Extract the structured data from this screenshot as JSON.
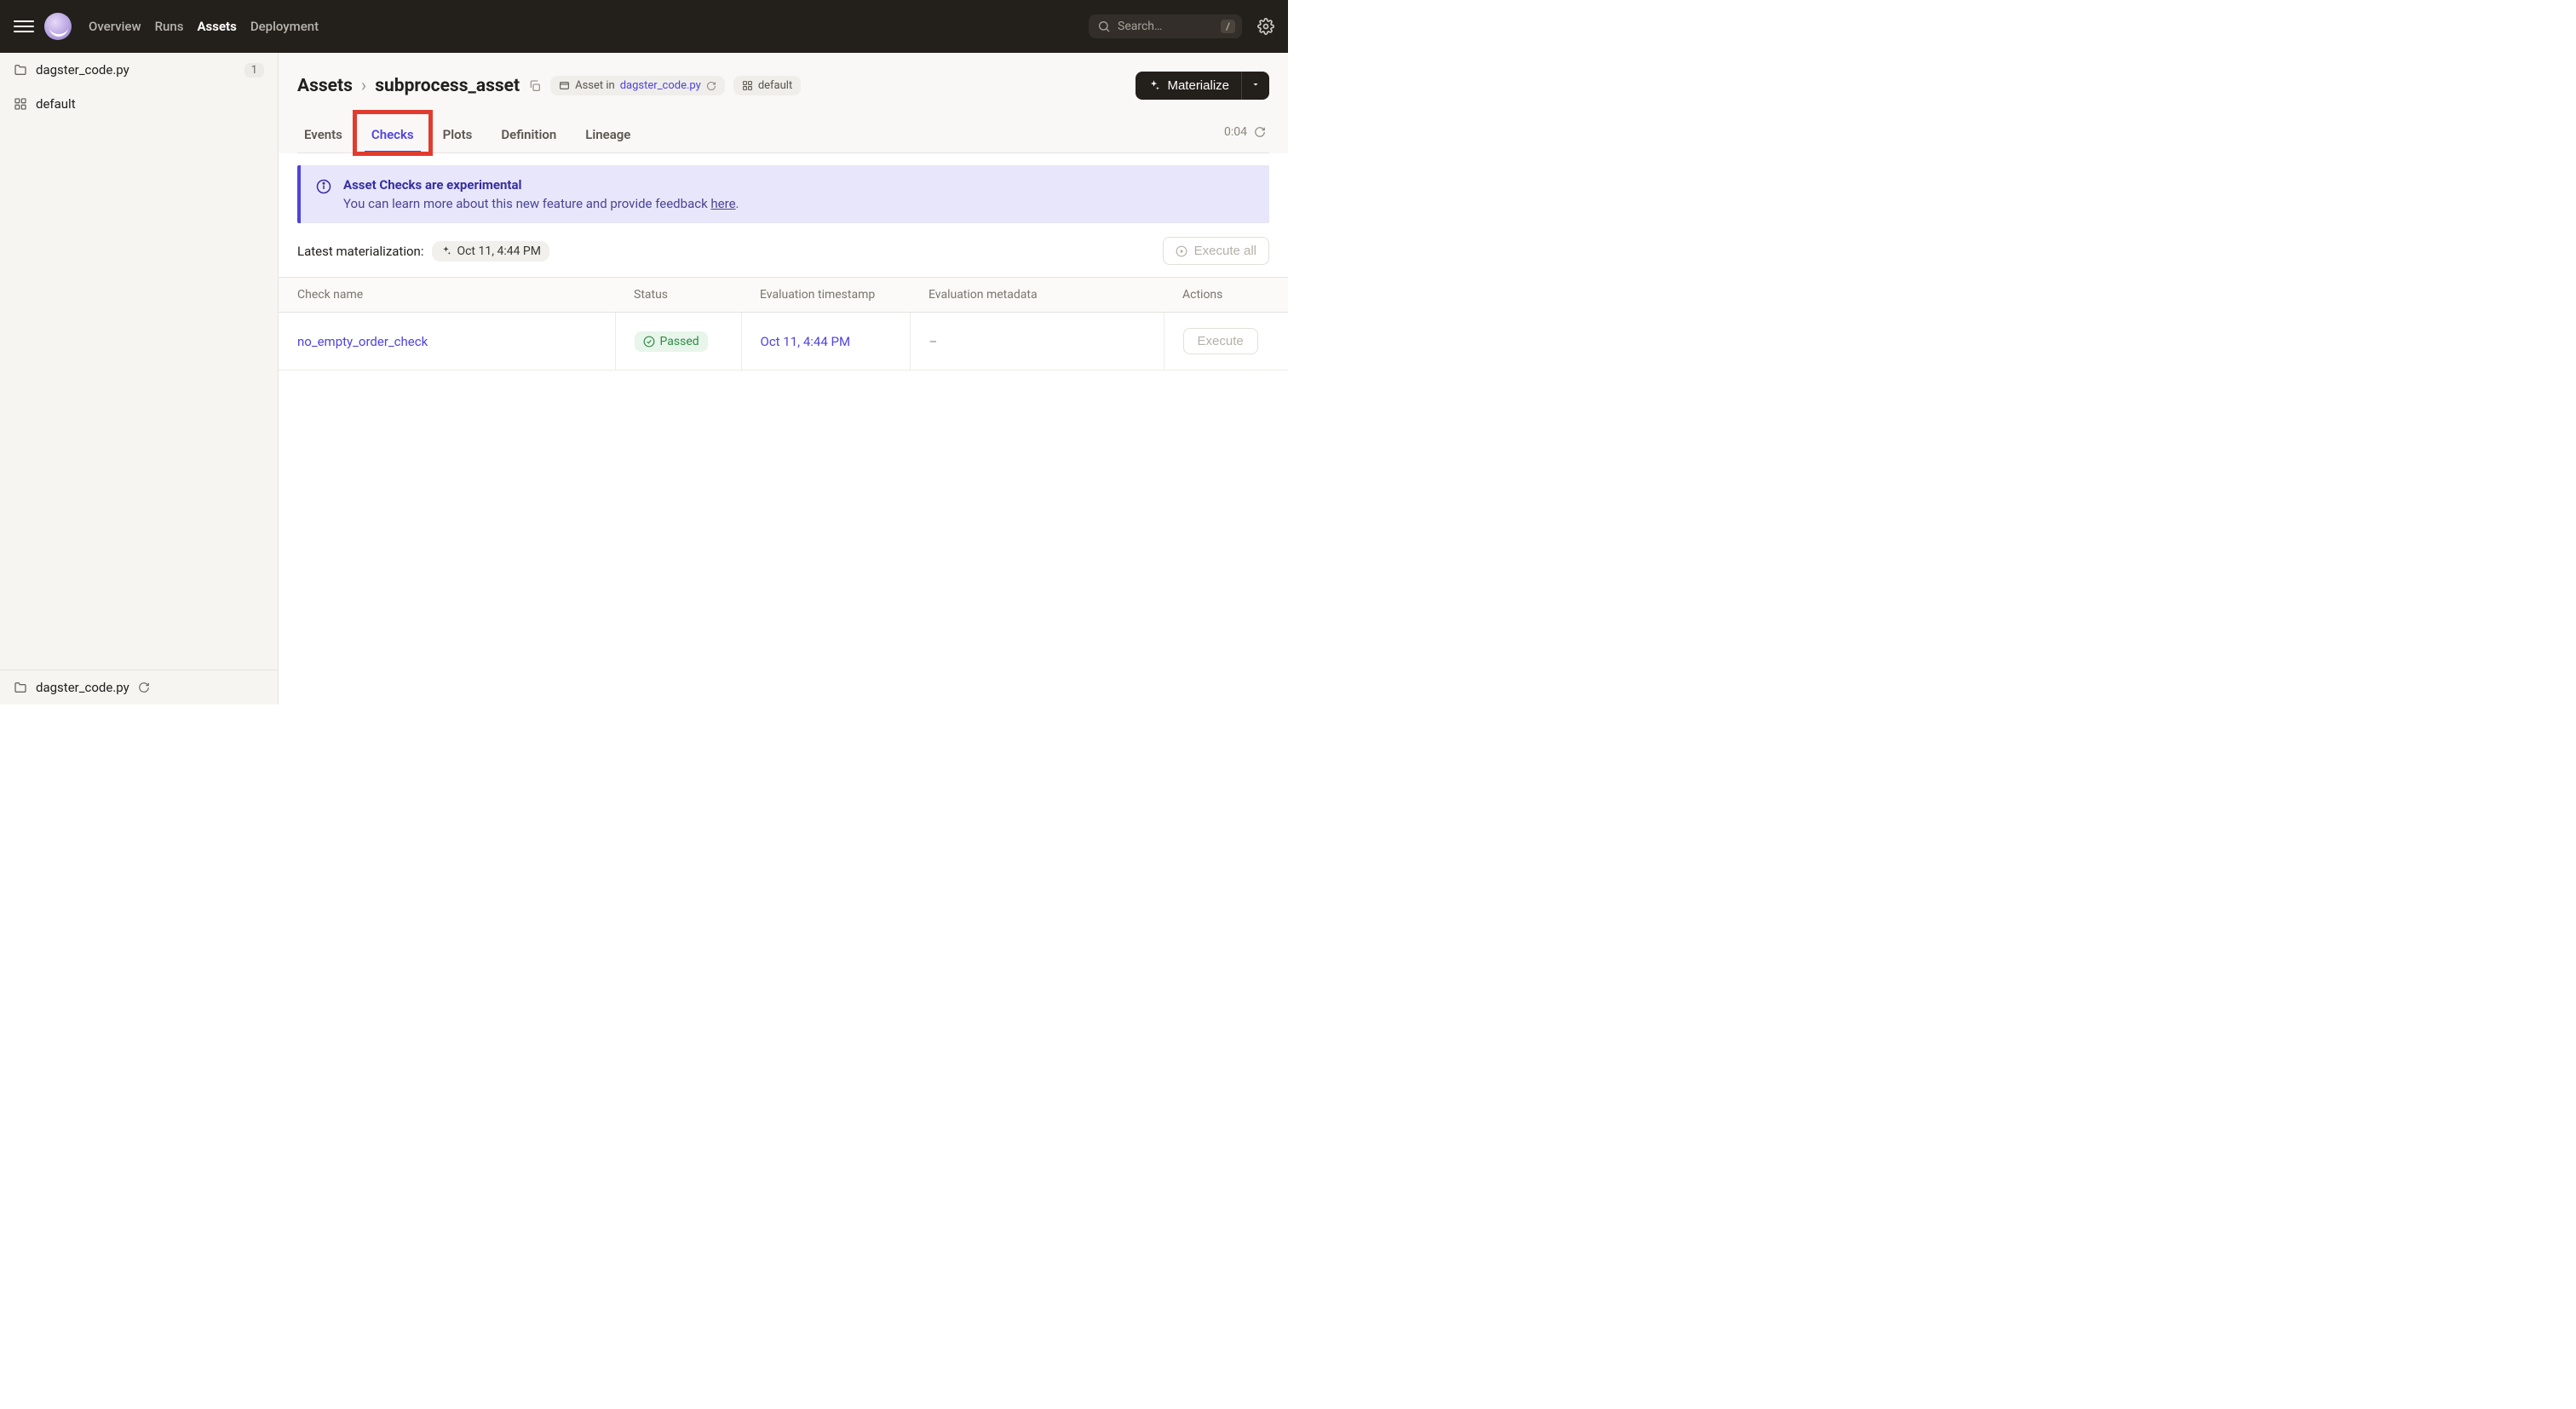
{
  "nav": {
    "links": [
      {
        "label": "Overview",
        "active": false
      },
      {
        "label": "Runs",
        "active": false
      },
      {
        "label": "Assets",
        "active": true
      },
      {
        "label": "Deployment",
        "active": false
      }
    ],
    "search_placeholder": "Search…",
    "search_shortcut": "/"
  },
  "sidebar": {
    "items": [
      {
        "icon": "folder",
        "label": "dagster_code.py",
        "badge": "1"
      },
      {
        "icon": "asset-group",
        "label": "default"
      }
    ],
    "footer": {
      "icon": "folder",
      "label": "dagster_code.py"
    }
  },
  "breadcrumb": {
    "root": "Assets",
    "asset_name": "subprocess_asset"
  },
  "header_chips": {
    "asset_in_prefix": "Asset in ",
    "asset_in_link": "dagster_code.py",
    "group": "default"
  },
  "materialize_button": "Materialize",
  "tabs": [
    {
      "id": "events",
      "label": "Events"
    },
    {
      "id": "checks",
      "label": "Checks",
      "active": true
    },
    {
      "id": "plots",
      "label": "Plots"
    },
    {
      "id": "definition",
      "label": "Definition"
    },
    {
      "id": "lineage",
      "label": "Lineage"
    }
  ],
  "tabs_timer": "0:04",
  "banner": {
    "title": "Asset Checks are experimental",
    "body_prefix": "You can learn more about this new feature and provide feedback ",
    "body_link": "here",
    "body_suffix": "."
  },
  "materialization": {
    "label": "Latest materialization:",
    "timestamp": "Oct 11, 4:44 PM",
    "execute_all": "Execute all"
  },
  "table": {
    "columns": [
      "Check name",
      "Status",
      "Evaluation timestamp",
      "Evaluation metadata",
      "Actions"
    ],
    "rows": [
      {
        "name": "no_empty_order_check",
        "status": "Passed",
        "timestamp": "Oct 11, 4:44 PM",
        "metadata": "–",
        "action": "Execute"
      }
    ]
  }
}
